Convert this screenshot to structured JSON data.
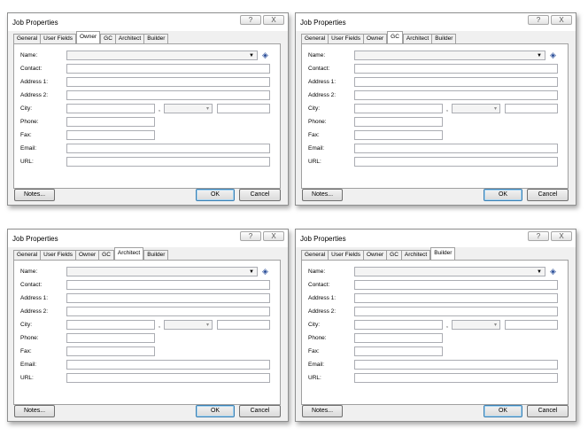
{
  "dialogs": [
    {
      "title": "Job Properties",
      "help_glyph": "?",
      "close_glyph": "X",
      "tabs": [
        {
          "label": "General",
          "active": false
        },
        {
          "label": "User Fields",
          "active": false
        },
        {
          "label": "Owner",
          "active": true
        },
        {
          "label": "GC",
          "active": false
        },
        {
          "label": "Architect",
          "active": false
        },
        {
          "label": "Builder",
          "active": false
        }
      ],
      "fields": {
        "name": "Name:",
        "contact": "Contact:",
        "address1": "Address 1:",
        "address2": "Address 2:",
        "city": "City:",
        "phone": "Phone:",
        "fax": "Fax:",
        "email": "Email:",
        "url": "URL:"
      },
      "city_separator": ",",
      "buttons": {
        "notes": "Notes...",
        "ok": "OK",
        "cancel": "Cancel"
      }
    },
    {
      "title": "Job Properties",
      "help_glyph": "?",
      "close_glyph": "X",
      "tabs": [
        {
          "label": "General",
          "active": false
        },
        {
          "label": "User Fields",
          "active": false
        },
        {
          "label": "Owner",
          "active": false
        },
        {
          "label": "GC",
          "active": true
        },
        {
          "label": "Architect",
          "active": false
        },
        {
          "label": "Builder",
          "active": false
        }
      ],
      "fields": {
        "name": "Name:",
        "contact": "Contact:",
        "address1": "Address 1:",
        "address2": "Address 2:",
        "city": "City:",
        "phone": "Phone:",
        "fax": "Fax:",
        "email": "Email:",
        "url": "URL:"
      },
      "city_separator": ",",
      "buttons": {
        "notes": "Notes...",
        "ok": "OK",
        "cancel": "Cancel"
      }
    },
    {
      "title": "Job Properties",
      "help_glyph": "?",
      "close_glyph": "X",
      "tabs": [
        {
          "label": "General",
          "active": false
        },
        {
          "label": "User Fields",
          "active": false
        },
        {
          "label": "Owner",
          "active": false
        },
        {
          "label": "GC",
          "active": false
        },
        {
          "label": "Architect",
          "active": true
        },
        {
          "label": "Builder",
          "active": false
        }
      ],
      "fields": {
        "name": "Name:",
        "contact": "Contact:",
        "address1": "Address 1:",
        "address2": "Address 2:",
        "city": "City:",
        "phone": "Phone:",
        "fax": "Fax:",
        "email": "Email:",
        "url": "URL:"
      },
      "city_separator": ",",
      "buttons": {
        "notes": "Notes...",
        "ok": "OK",
        "cancel": "Cancel"
      }
    },
    {
      "title": "Job Properties",
      "help_glyph": "?",
      "close_glyph": "X",
      "tabs": [
        {
          "label": "General",
          "active": false
        },
        {
          "label": "User Fields",
          "active": false
        },
        {
          "label": "Owner",
          "active": false
        },
        {
          "label": "GC",
          "active": false
        },
        {
          "label": "Architect",
          "active": false
        },
        {
          "label": "Builder",
          "active": true
        }
      ],
      "fields": {
        "name": "Name:",
        "contact": "Contact:",
        "address1": "Address 1:",
        "address2": "Address 2:",
        "city": "City:",
        "phone": "Phone:",
        "fax": "Fax:",
        "email": "Email:",
        "url": "URL:"
      },
      "city_separator": ",",
      "buttons": {
        "notes": "Notes...",
        "ok": "OK",
        "cancel": "Cancel"
      }
    }
  ]
}
